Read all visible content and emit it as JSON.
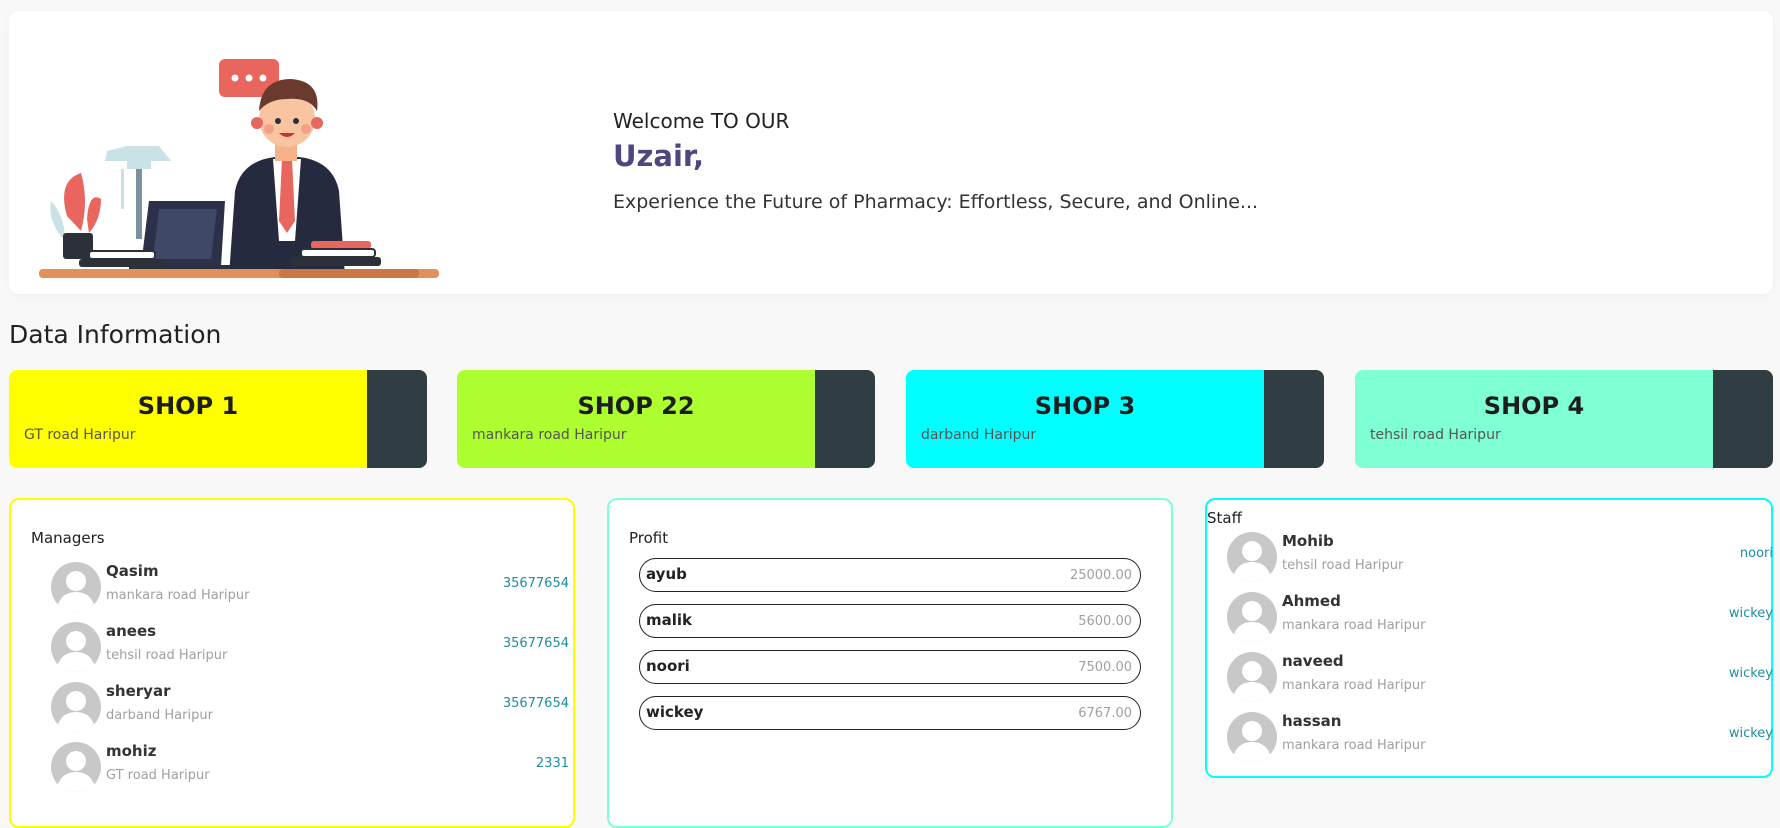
{
  "hero": {
    "welcome": "Welcome TO OUR",
    "name": "Uzair,",
    "tagline": "Experience the Future of Pharmacy: Effortless, Secure, and Online..."
  },
  "section_title": "Data Information",
  "shops": [
    {
      "title": "SHOP 1",
      "location": "GT road Haripur",
      "color": "#ffff00"
    },
    {
      "title": "SHOP 22",
      "location": "mankara road Haripur",
      "color": "#adff2f"
    },
    {
      "title": "SHOP 3",
      "location": "darband Haripur",
      "color": "#00ffff"
    },
    {
      "title": "SHOP 4",
      "location": "tehsil road Haripur",
      "color": "#7fffd4"
    }
  ],
  "managers": {
    "title": "Managers",
    "border_color": "#ffff00",
    "items": [
      {
        "name": "Qasim",
        "location": "mankara road Haripur",
        "value": "35677654"
      },
      {
        "name": "anees",
        "location": "tehsil road Haripur",
        "value": "35677654"
      },
      {
        "name": "sheryar",
        "location": "darband Haripur",
        "value": "35677654"
      },
      {
        "name": "mohiz",
        "location": "GT road Haripur",
        "value": "2331"
      }
    ]
  },
  "profit": {
    "title": "Profit",
    "border_color": "#7fffd4",
    "items": [
      {
        "name": "ayub",
        "value": "25000.00"
      },
      {
        "name": "malik",
        "value": "5600.00"
      },
      {
        "name": "noori",
        "value": "7500.00"
      },
      {
        "name": "wickey",
        "value": "6767.00"
      }
    ]
  },
  "staff": {
    "title": "Staff",
    "border_color": "#00ffff",
    "items": [
      {
        "name": "Mohib",
        "location": "tehsil road Haripur",
        "value": "noori"
      },
      {
        "name": "Ahmed",
        "location": "mankara road Haripur",
        "value": "wickey"
      },
      {
        "name": "naveed",
        "location": "mankara road Haripur",
        "value": "wickey"
      },
      {
        "name": "hassan",
        "location": "mankara road Haripur",
        "value": "wickey"
      }
    ]
  },
  "colors": {
    "accent_name": "#51457f",
    "shop_side": "#303d43",
    "link": "#1d8ea4"
  },
  "icons": {
    "hero_illustration": "businessman-at-desk-illustration",
    "avatar": "user-avatar-placeholder-icon"
  }
}
